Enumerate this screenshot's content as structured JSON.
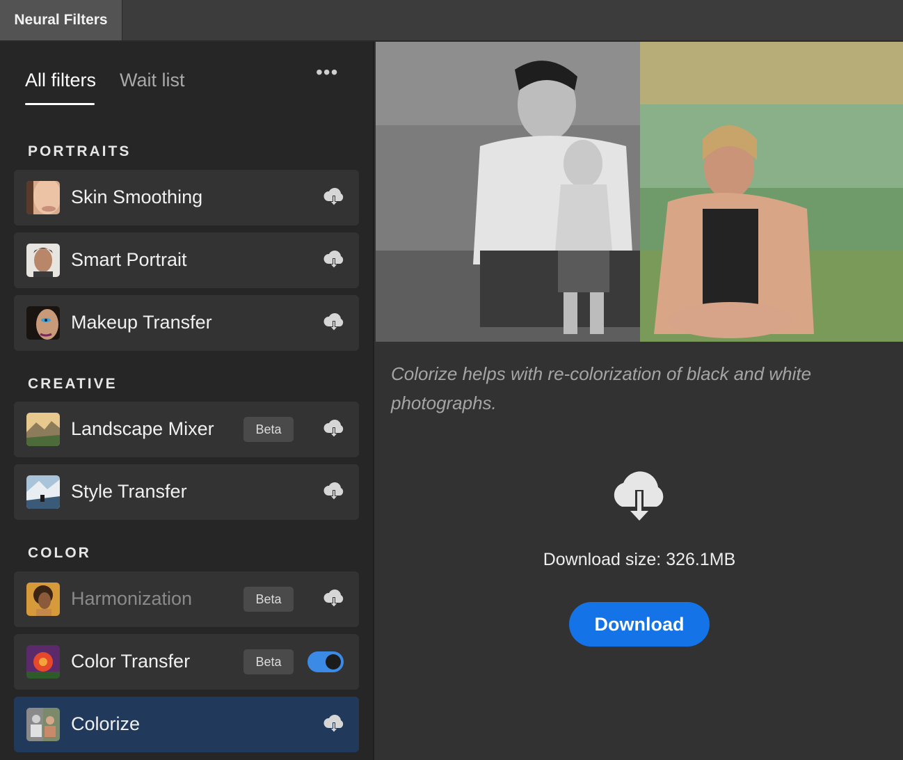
{
  "window": {
    "tab_title": "Neural Filters"
  },
  "filter_tabs": {
    "all": "All filters",
    "wait": "Wait list"
  },
  "sections": {
    "portraits": "PORTRAITS",
    "creative": "CREATIVE",
    "color": "COLOR"
  },
  "filters": [
    {
      "label": "Skin Smoothing",
      "beta": false,
      "state": "download"
    },
    {
      "label": "Smart Portrait",
      "beta": false,
      "state": "download"
    },
    {
      "label": "Makeup Transfer",
      "beta": false,
      "state": "download"
    },
    {
      "label": "Landscape Mixer",
      "beta": true,
      "beta_label": "Beta",
      "state": "download"
    },
    {
      "label": "Style Transfer",
      "beta": false,
      "state": "download"
    },
    {
      "label": "Harmonization",
      "beta": true,
      "beta_label": "Beta",
      "state": "download",
      "disabled": true
    },
    {
      "label": "Color Transfer",
      "beta": true,
      "beta_label": "Beta",
      "state": "toggle-on"
    },
    {
      "label": "Colorize",
      "beta": false,
      "state": "download",
      "selected": true
    }
  ],
  "detail": {
    "description": "Colorize helps with re-colorization of black and white photographs.",
    "download_size": "Download size: 326.1MB",
    "download_button": "Download",
    "icon": "cloud-download-icon"
  },
  "colors": {
    "accent": "#1473e6",
    "selected_card": "#213a5c",
    "toggle_on": "#3a8ae6"
  }
}
